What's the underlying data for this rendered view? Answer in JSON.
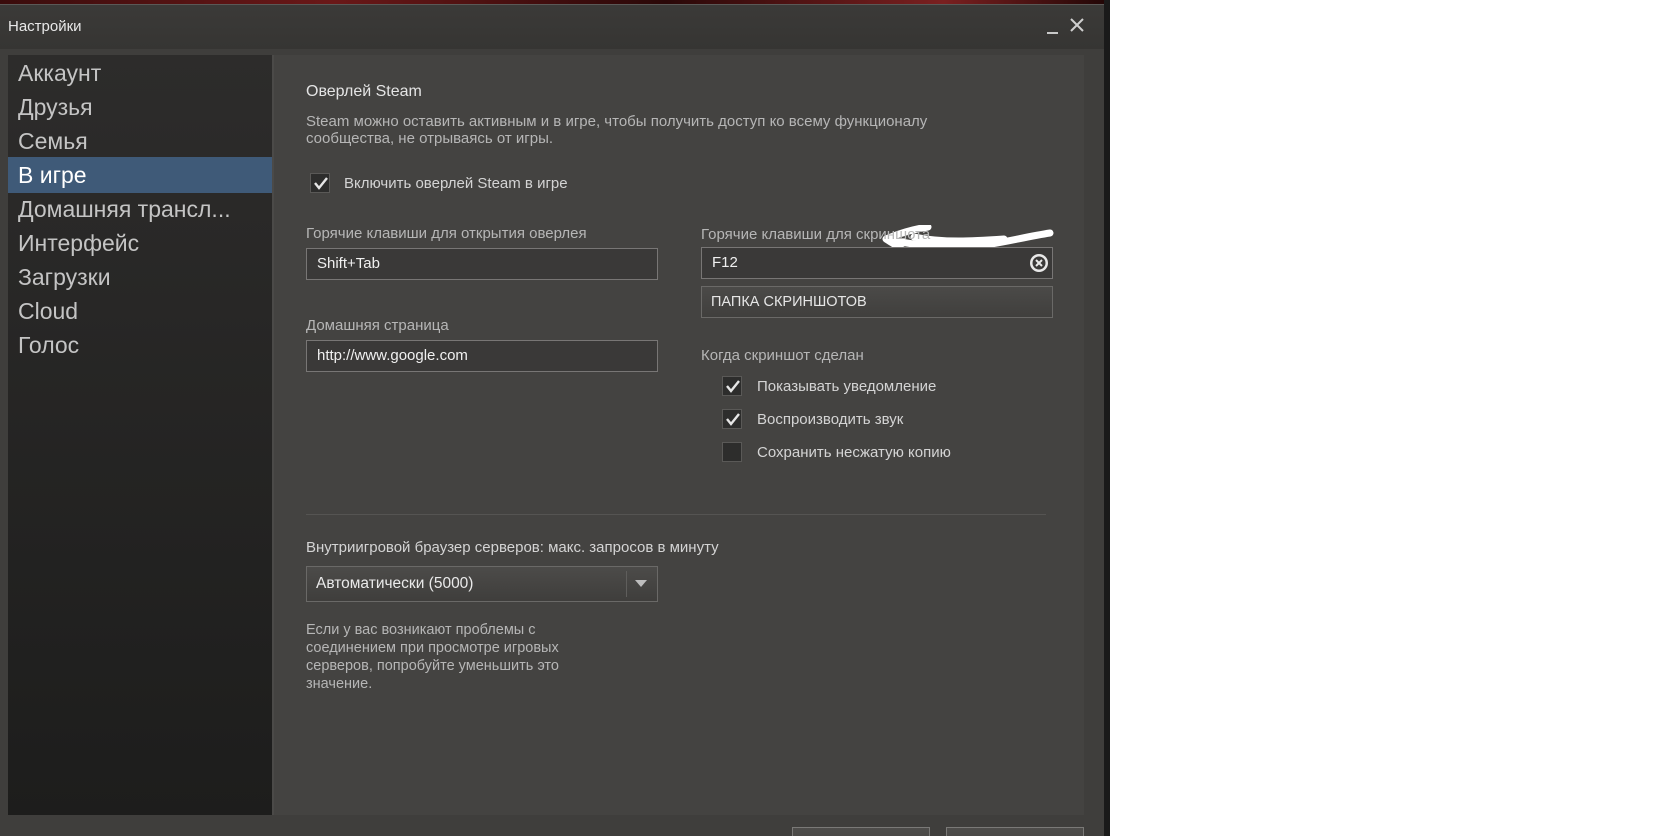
{
  "window": {
    "title": "Настройки"
  },
  "sidebar": {
    "items": [
      {
        "label": "Аккаунт"
      },
      {
        "label": "Друзья"
      },
      {
        "label": "Семья"
      },
      {
        "label": "В игре",
        "active": true
      },
      {
        "label": "Домашняя трансл..."
      },
      {
        "label": "Интерфейс"
      },
      {
        "label": "Загрузки"
      },
      {
        "label": "Cloud"
      },
      {
        "label": "Голос"
      }
    ]
  },
  "overlay": {
    "heading": "Оверлей Steam",
    "description_line1": "Steam можно оставить активным и в игре, чтобы получить доступ ко всему функционалу",
    "description_line2": "сообщества, не отрываясь от игры.",
    "enable_label": "Включить оверлей Steam в игре",
    "enable_checked": true
  },
  "hotkeys_overlay": {
    "label": "Горячие клавиши для открытия оверлея",
    "value": "Shift+Tab"
  },
  "homepage": {
    "label": "Домашняя страница",
    "value": "http://www.google.com"
  },
  "hotkeys_screenshot": {
    "label": "Горячие клавиши для скриншота",
    "value": "F12",
    "folder_button": "ПАПКА СКРИНШОТОВ"
  },
  "screenshot_taken": {
    "label": "Когда скриншот сделан",
    "options": [
      {
        "label": "Показывать уведомление",
        "checked": true
      },
      {
        "label": "Воспроизводить звук",
        "checked": true
      },
      {
        "label": "Сохранить несжатую копию",
        "checked": false
      }
    ]
  },
  "server_browser": {
    "label": "Внутриигровой браузер серверов: макс. запросов в минуту",
    "selected": "Автоматически (5000)",
    "help_line1": "Если у вас возникают проблемы с",
    "help_line2": "соединением при просмотре игровых",
    "help_line3": "серверов, попробуйте уменьшить это",
    "help_line4": "значение."
  },
  "colors": {
    "window_bg": "#3f3e3c",
    "content_bg": "#444341",
    "active_item": "#3f5a78"
  }
}
